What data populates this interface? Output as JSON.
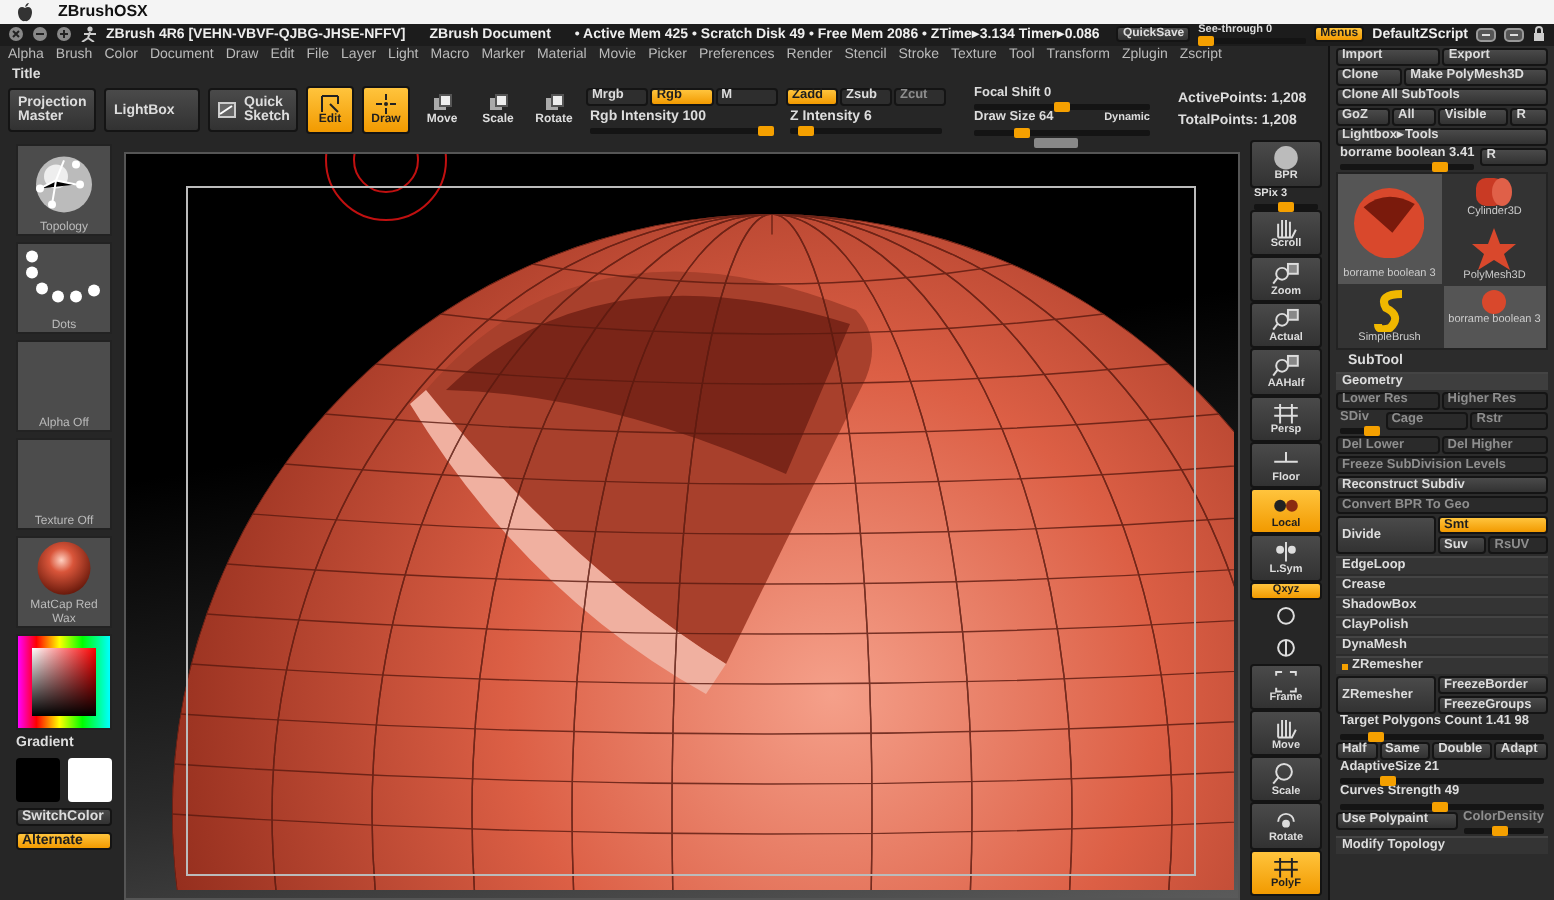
{
  "os_bar": {
    "app_name": "ZBrushOSX"
  },
  "title_bar": {
    "title": "ZBrush 4R6 [VEHN-VBVF-QJBG-JHSE-NFFV]",
    "document": "ZBrush Document",
    "stats": "• Active Mem 425 • Scratch Disk 49 • Free Mem 2086 • ZTime▸3.134 Timer▸0.086",
    "quicksave": "QuickSave",
    "see_through": {
      "label": "See-through  0",
      "level": 0
    },
    "menus": {
      "label": "Menus",
      "on": true
    },
    "script": "DefaultZScript"
  },
  "menu_bar": [
    "Alpha",
    "Brush",
    "Color",
    "Document",
    "Draw",
    "Edit",
    "File",
    "Layer",
    "Light",
    "Macro",
    "Marker",
    "Material",
    "Movie",
    "Picker",
    "Preferences",
    "Render",
    "Stencil",
    "Stroke",
    "Texture",
    "Tool",
    "Transform",
    "Zplugin",
    "Zscript"
  ],
  "palette_title": "Title",
  "top_shelf": {
    "big_buttons": [
      {
        "kind": "projection",
        "label": "Projection Master"
      },
      {
        "kind": "lightbox",
        "label": "LightBox"
      },
      {
        "kind": "sketch",
        "label": "Quick Sketch"
      }
    ],
    "modes": [
      {
        "kind": "edit",
        "label": "Edit",
        "on": true
      },
      {
        "kind": "draw",
        "label": "Draw",
        "on": true
      },
      {
        "kind": "move",
        "label": "Move",
        "on": false
      },
      {
        "kind": "scale",
        "label": "Scale",
        "on": false
      },
      {
        "kind": "rotate",
        "label": "Rotate",
        "on": false
      }
    ],
    "color_toggles": [
      {
        "label": "Mrgb",
        "on": false
      },
      {
        "label": "Rgb",
        "on": true
      },
      {
        "label": "M",
        "on": false
      }
    ],
    "rgb_intensity": {
      "label": "Rgb Intensity 100",
      "level": 1
    },
    "depth_toggles": [
      {
        "label": "Zadd",
        "on": true,
        "disabled": false
      },
      {
        "label": "Zsub",
        "on": false,
        "disabled": false
      },
      {
        "label": "Zcut",
        "on": false,
        "disabled": true
      }
    ],
    "z_intensity": {
      "label": "Z Intensity 6",
      "level": 0.06
    },
    "focal_shift": {
      "label": "Focal Shift 0",
      "level": 0.5
    },
    "draw_size": {
      "label": "Draw Size 64",
      "level": 0.25
    },
    "dynamic": "Dynamic",
    "active_points": "ActivePoints: 1,208",
    "total_points": "TotalPoints: 1,208"
  },
  "left_shelf": [
    {
      "kind": "brush",
      "label": "Topology"
    },
    {
      "kind": "stroke",
      "label": "Dots"
    },
    {
      "kind": "alpha",
      "label": "Alpha Off"
    },
    {
      "kind": "texture",
      "label": "Texture Off"
    },
    {
      "kind": "material",
      "label": "MatCap Red Wax"
    }
  ],
  "color_palette": {
    "gradient": "Gradient",
    "swatches": [
      {
        "color": "#000000"
      },
      {
        "color": "#ffffff"
      }
    ],
    "switch": "SwitchColor",
    "alternate": {
      "label": "Alternate",
      "on": true
    }
  },
  "right_shelf": [
    {
      "kind": "bpr",
      "label": "BPR",
      "on": false
    },
    {
      "kind": "spix",
      "label": "SPix 3",
      "level": 0.5
    },
    {
      "kind": "scroll",
      "label": "Scroll",
      "on": false
    },
    {
      "kind": "zoom",
      "label": "Zoom",
      "on": false
    },
    {
      "kind": "actual",
      "label": "Actual",
      "on": false
    },
    {
      "kind": "aahalf",
      "label": "AAHalf",
      "on": false
    },
    {
      "kind": "persp",
      "label": "Persp",
      "on": false
    },
    {
      "kind": "floor",
      "label": "Floor",
      "on": false
    },
    {
      "kind": "local",
      "label": "Local",
      "on": true
    },
    {
      "kind": "lsym",
      "label": "L.Sym",
      "on": false
    },
    {
      "kind": "qxyz",
      "label": "Qxyz",
      "on": true
    },
    {
      "kind": "roty",
      "on": false
    },
    {
      "kind": "rotz",
      "on": false
    },
    {
      "kind": "frame",
      "label": "Frame",
      "on": false
    },
    {
      "kind": "move",
      "label": "Move",
      "on": false
    },
    {
      "kind": "scale",
      "label": "Scale",
      "on": false
    },
    {
      "kind": "rotate",
      "label": "Rotate",
      "on": false
    },
    {
      "kind": "polyf",
      "label": "PolyF",
      "on": true
    }
  ],
  "tool_palette": [
    [
      {
        "kind": "btn",
        "label": "Import",
        "disabled": false
      },
      {
        "kind": "btn",
        "label": "Export",
        "disabled": false
      }
    ],
    [
      {
        "kind": "btn",
        "label": "Clone",
        "disabled": false
      },
      {
        "kind": "btn",
        "label": "Make PolyMesh3D",
        "disabled": false
      }
    ],
    [
      {
        "kind": "btn",
        "label": "Clone All SubTools",
        "disabled": false
      }
    ],
    [
      {
        "kind": "btn",
        "label": "GoZ",
        "disabled": false
      },
      {
        "kind": "btn",
        "label": "All",
        "disabled": false
      },
      {
        "kind": "btn",
        "label": "Visible",
        "disabled": false
      },
      {
        "kind": "btn",
        "label": "R",
        "disabled": false
      }
    ],
    [
      {
        "kind": "btn",
        "label": "Lightbox▸Tools",
        "disabled": false
      }
    ],
    [
      {
        "kind": "slider",
        "label": "borrame boolean 3.41",
        "level": 0.78,
        "disabled": false
      },
      {
        "kind": "btn",
        "label": "R",
        "disabled": false
      }
    ],
    [
      {
        "kind": "thumbs",
        "items": [
          {
            "kind": "cutsphere",
            "label": "borrame boolean 3",
            "selected": true
          },
          {
            "kind": "brush",
            "label": "SimpleBrush",
            "selected": false
          },
          {
            "kind": "cylinder",
            "label": "Cylinder3D",
            "selected": false
          },
          {
            "kind": "star",
            "label": "PolyMesh3D",
            "selected": false
          },
          {
            "kind": "ball",
            "label": "borrame boolean 3",
            "selected": true
          }
        ]
      }
    ],
    [
      {
        "kind": "heading",
        "label": "SubTool"
      }
    ],
    [
      {
        "kind": "group",
        "label": "Geometry"
      }
    ],
    [
      {
        "kind": "btn",
        "label": "Lower Res",
        "disabled": true
      },
      {
        "kind": "btn",
        "label": "Higher Res",
        "disabled": true
      }
    ],
    [
      {
        "kind": "slider",
        "label": "SDiv",
        "level": 1,
        "disabled": true
      },
      {
        "kind": "btn",
        "label": "Cage",
        "disabled": true
      },
      {
        "kind": "btn",
        "label": "Rstr",
        "disabled": true
      }
    ],
    [
      {
        "kind": "btn",
        "label": "Del Lower",
        "disabled": true
      },
      {
        "kind": "btn",
        "label": "Del Higher",
        "disabled": true
      }
    ],
    [
      {
        "kind": "btn",
        "label": "Freeze SubDivision Levels",
        "disabled": true
      }
    ],
    [
      {
        "kind": "btn",
        "label": "Reconstruct Subdiv",
        "disabled": false
      }
    ],
    [
      {
        "kind": "btn",
        "label": "Convert BPR To Geo",
        "disabled": true
      }
    ],
    [
      {
        "kind": "split",
        "main": {
          "label": "Divide"
        },
        "side": [
          [
            {
              "kind": "btn",
              "label": "Smt",
              "on": true,
              "disabled": false
            }
          ],
          [
            {
              "kind": "btn",
              "label": "Suv",
              "on": false,
              "disabled": false
            },
            {
              "kind": "btn",
              "label": "RsUV",
              "on": false,
              "disabled": true
            }
          ]
        ]
      }
    ],
    [
      {
        "kind": "section",
        "label": "EdgeLoop",
        "expanded": false
      }
    ],
    [
      {
        "kind": "section",
        "label": "Crease",
        "expanded": false
      }
    ],
    [
      {
        "kind": "section",
        "label": "ShadowBox",
        "expanded": false
      }
    ],
    [
      {
        "kind": "section",
        "label": "ClayPolish",
        "expanded": false
      }
    ],
    [
      {
        "kind": "section",
        "label": "DynaMesh",
        "expanded": false
      }
    ],
    [
      {
        "kind": "section",
        "label": "ZRemesher",
        "expanded": true
      }
    ],
    [
      {
        "kind": "split",
        "main": {
          "label": "ZRemesher"
        },
        "side": [
          [
            {
              "kind": "btn",
              "label": "FreezeBorder",
              "on": false,
              "disabled": false
            }
          ],
          [
            {
              "kind": "btn",
              "label": "FreezeGroups",
              "on": false,
              "disabled": false
            }
          ]
        ]
      }
    ],
    [
      {
        "kind": "slider",
        "label": "Target Polygons Count 1.41 98",
        "level": 0.15,
        "disabled": false
      }
    ],
    [
      {
        "kind": "btn",
        "label": "Half",
        "disabled": false
      },
      {
        "kind": "btn",
        "label": "Same",
        "disabled": false
      },
      {
        "kind": "btn",
        "label": "Double",
        "disabled": false
      },
      {
        "kind": "btn",
        "label": "Adapt",
        "disabled": false
      }
    ],
    [
      {
        "kind": "slider",
        "label": "AdaptiveSize 21",
        "level": 0.21,
        "disabled": false
      }
    ],
    [
      {
        "kind": "slider",
        "label": "Curves Strength 49",
        "level": 0.49,
        "disabled": false
      }
    ],
    [
      {
        "kind": "btn",
        "label": "Use Polypaint",
        "disabled": false
      },
      {
        "kind": "slider",
        "label": "ColorDensity",
        "level": 0.45,
        "disabled": true
      }
    ],
    [
      {
        "kind": "section",
        "label": "Modify Topology",
        "expanded": false
      }
    ]
  ]
}
